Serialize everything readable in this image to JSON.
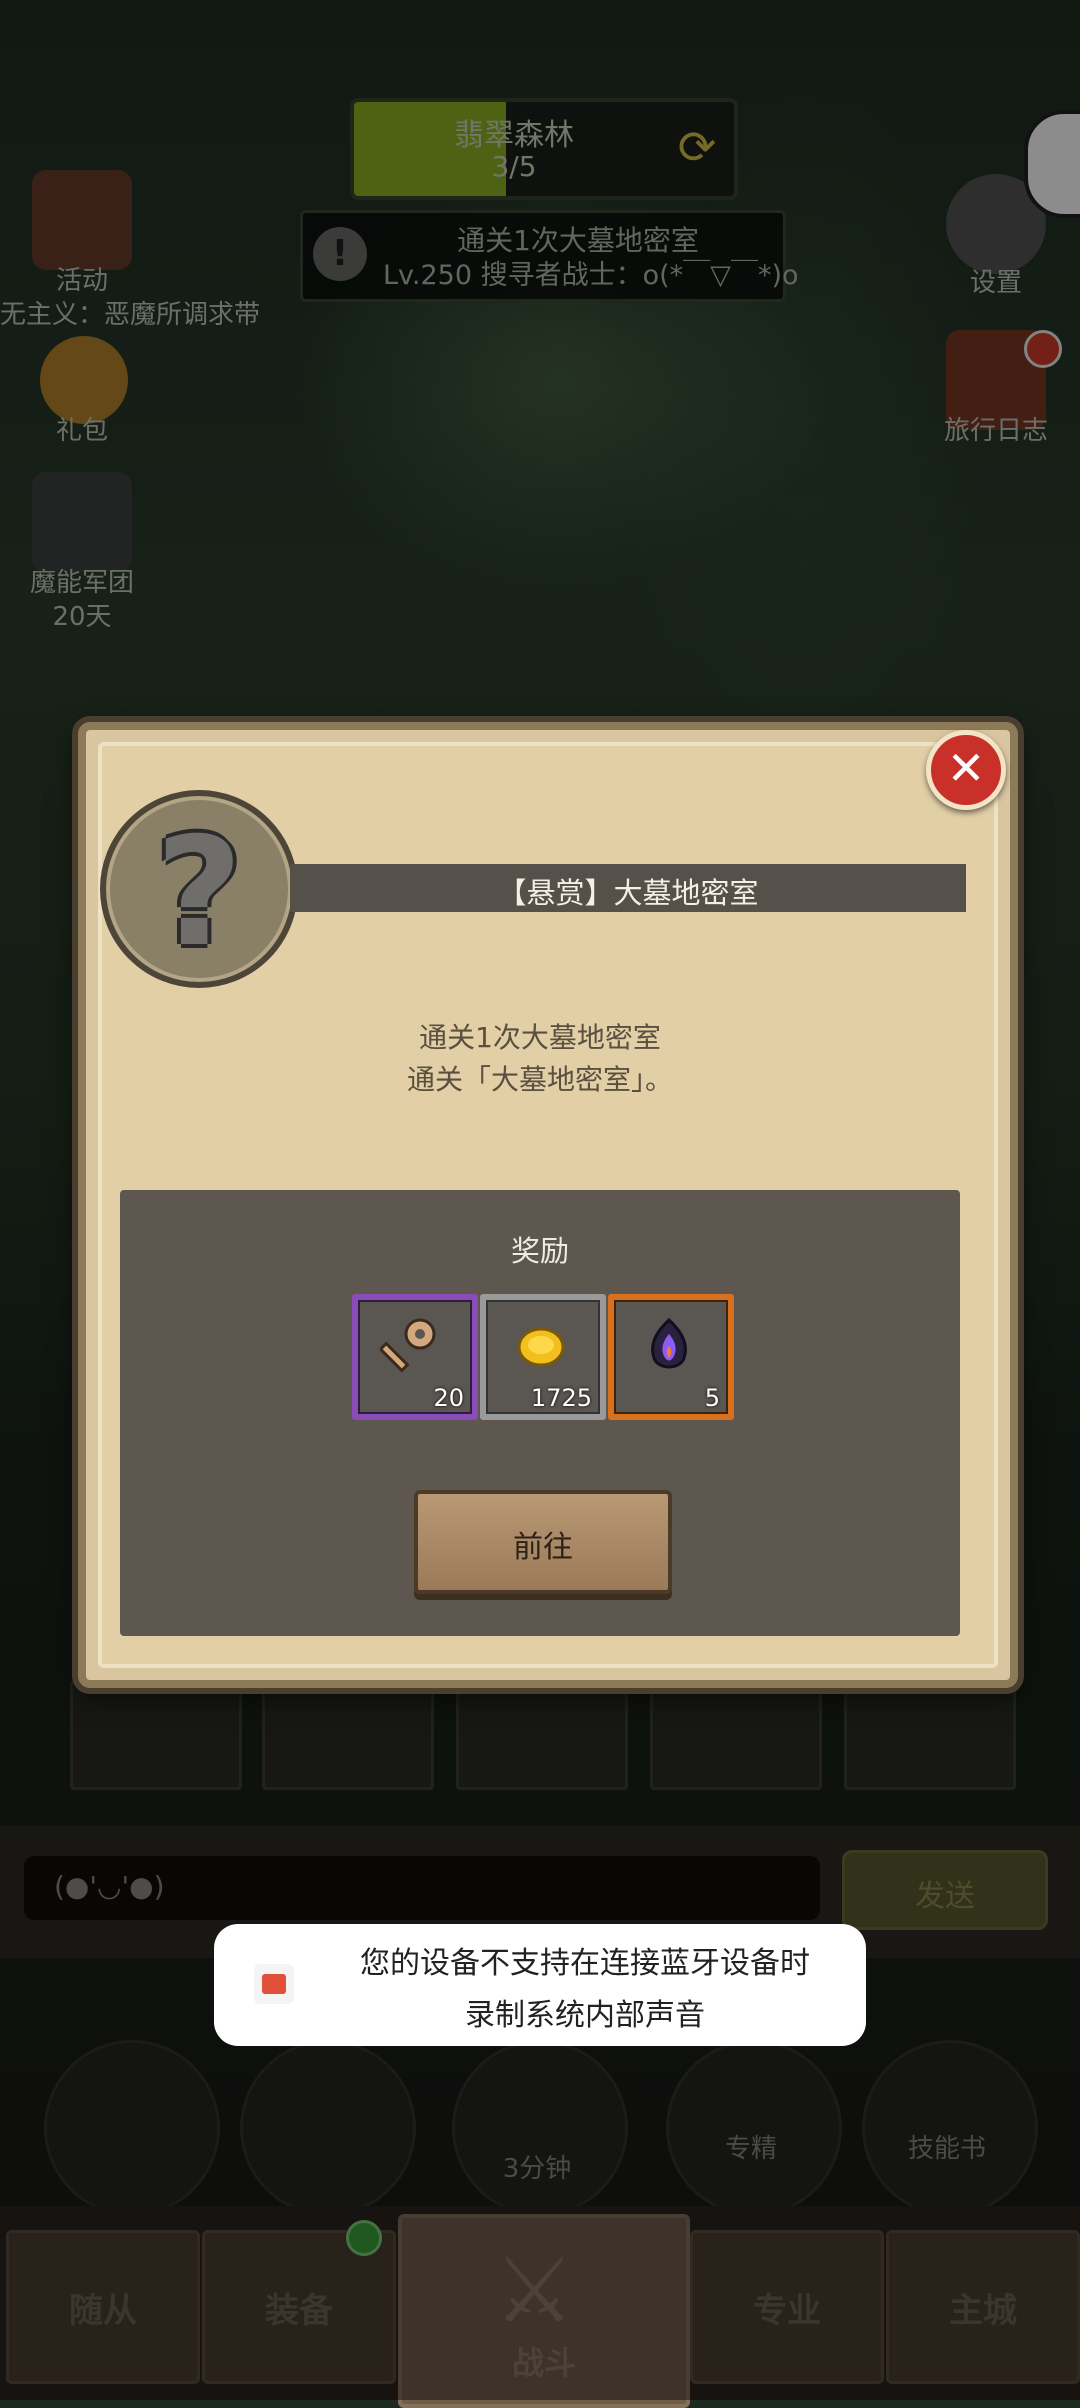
{
  "hud": {
    "stage_name": "翡翠森林",
    "stage_progress_text": "3/5",
    "stage_progress_value": 0.4,
    "quest_title": "通关1次大墓地密室",
    "quest_sub": "Lv.250 搜寻者战士：o(*￣▽￣*)o",
    "left_icons": [
      {
        "label": "活动"
      },
      {
        "label": "无主义：恶魔所调求带"
      },
      {
        "label": "礼包"
      },
      {
        "label": "魔能军团"
      },
      {
        "label": "20天"
      }
    ],
    "right_icons": [
      {
        "label": "设置"
      },
      {
        "label": "旅行日志"
      }
    ]
  },
  "modal": {
    "title": "【悬赏】大墓地密室",
    "desc_line1": "通关1次大墓地密室",
    "desc_line2": "通关「大墓地密室」。",
    "reward_title": "奖励",
    "rewards": [
      {
        "icon": "key-icon",
        "count": "20",
        "rarity": "purple"
      },
      {
        "icon": "gold-coin-icon",
        "count": "1725",
        "rarity": "gray"
      },
      {
        "icon": "purple-gem-icon",
        "count": "5",
        "rarity": "orange"
      }
    ],
    "go_button": "前往",
    "close_icon": "close-icon"
  },
  "chat": {
    "input_value": "(●'◡'●)",
    "send_button": "发送"
  },
  "toast": {
    "line1": "您的设备不支持在连接蓝牙设备时",
    "line2": "录制系统内部声音"
  },
  "quick_actions": [
    {
      "label": ""
    },
    {
      "label": ""
    },
    {
      "label": "3分钟"
    },
    {
      "label": "专精"
    },
    {
      "label": "技能书"
    }
  ],
  "nav": {
    "tabs": [
      "随从",
      "装备",
      "战斗",
      "专业",
      "主城"
    ]
  },
  "colors": {
    "close_red": "#c9302a",
    "progress_green": "#8fb324",
    "parchment": "#e2cfa6",
    "reward_panel": "#5d5750"
  }
}
